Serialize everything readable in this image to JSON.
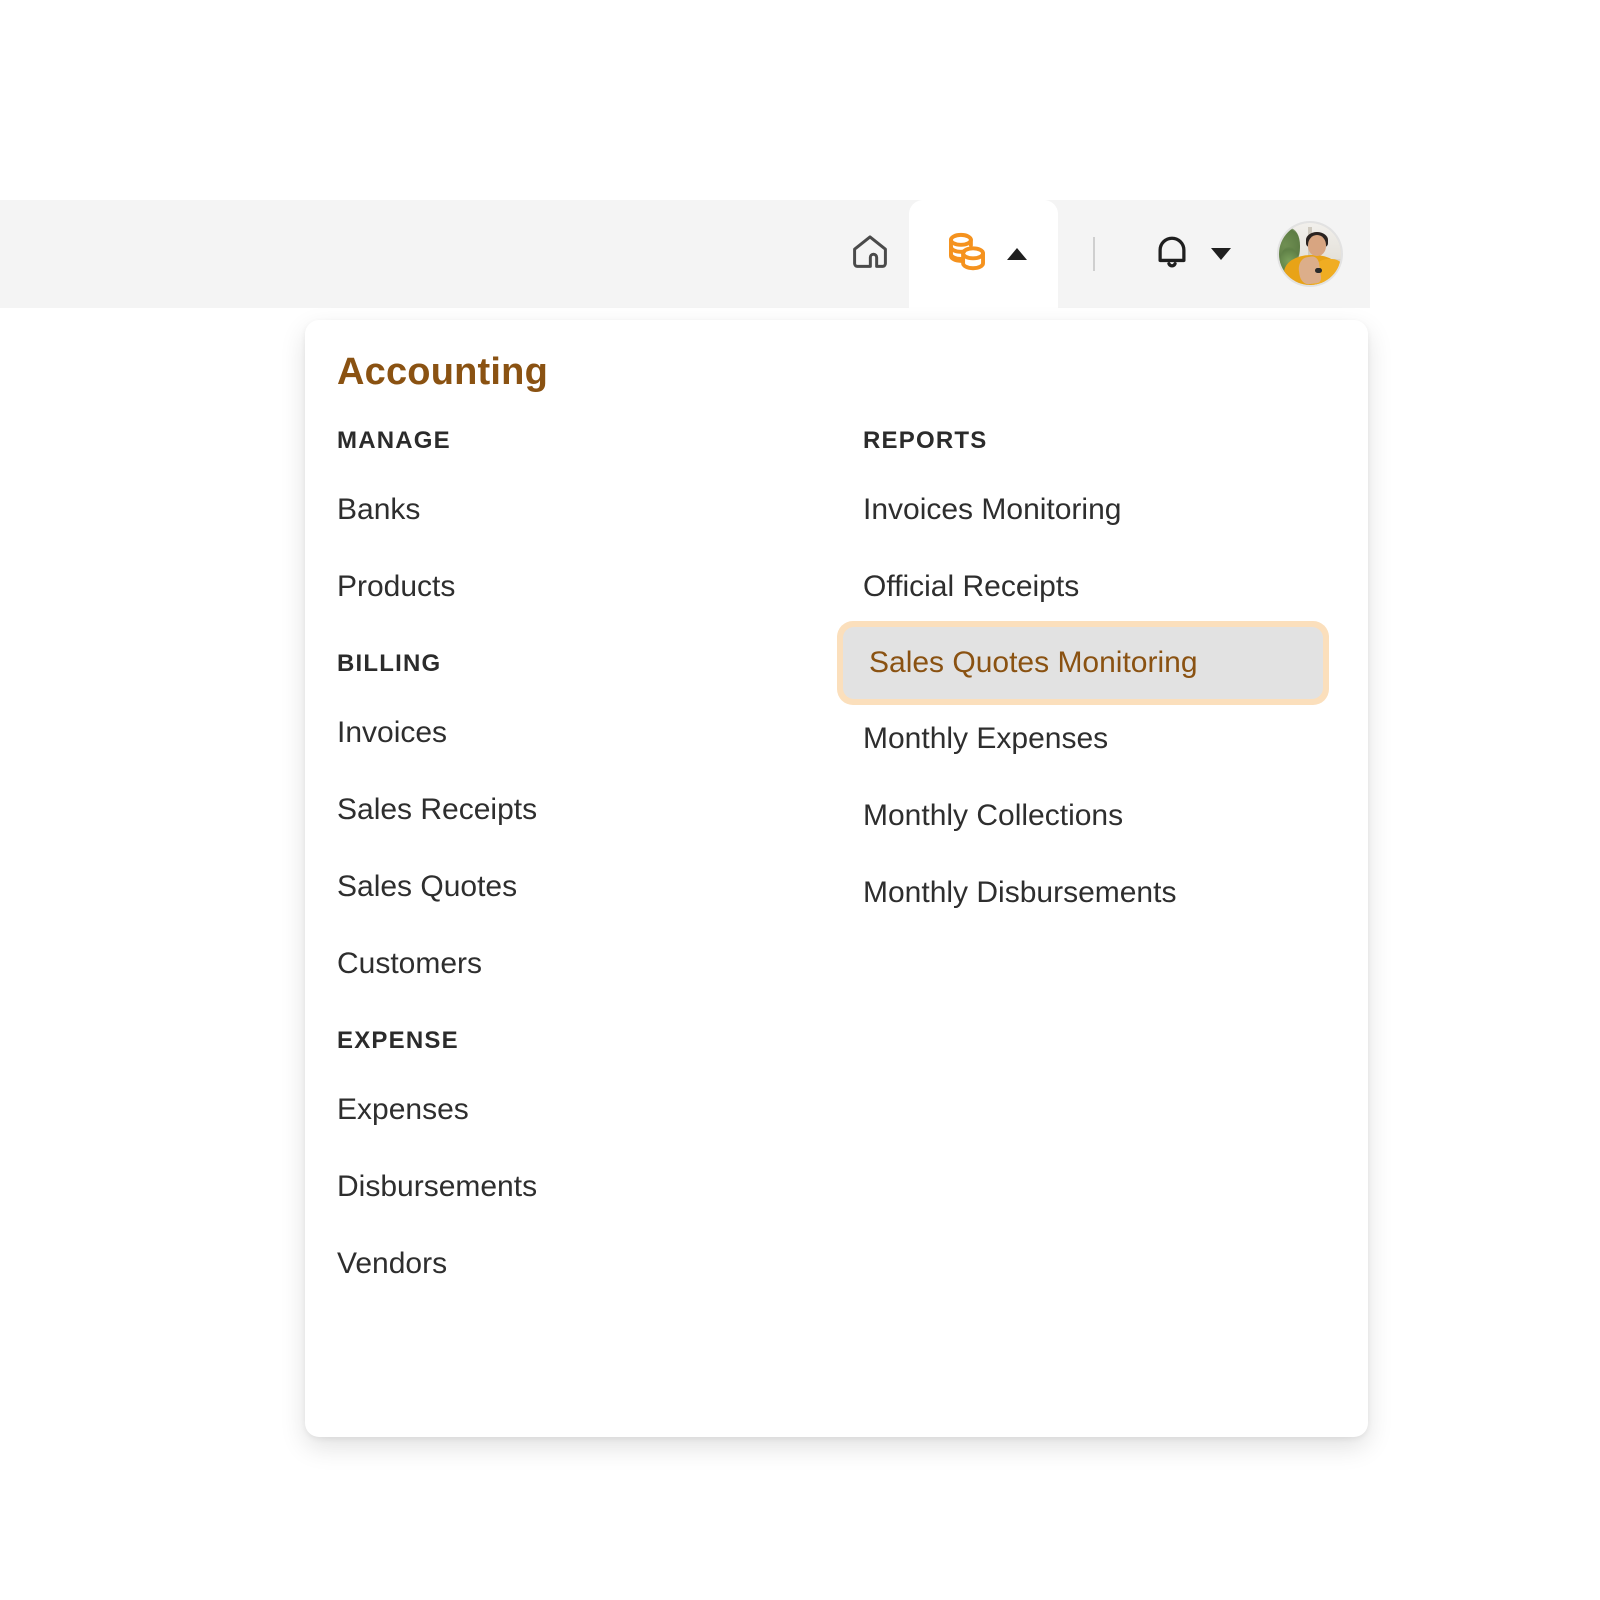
{
  "topbar": {
    "home_icon": "home-icon",
    "accounting_icon": "coins-icon",
    "accounting_caret": "caret-up-icon",
    "divider": "vertical-divider",
    "bell_icon": "bell-icon",
    "bell_caret": "caret-down-icon",
    "avatar": "user-avatar",
    "background": "#f4f4f4",
    "active_tab_background": "#ffffff",
    "accent_color": "#f5921e"
  },
  "menu": {
    "title": "Accounting",
    "title_color": "#8a5212",
    "left_column": [
      {
        "heading": "MANAGE",
        "items": [
          {
            "label": "Banks"
          },
          {
            "label": "Products"
          }
        ]
      },
      {
        "heading": "BILLING",
        "items": [
          {
            "label": "Invoices"
          },
          {
            "label": "Sales Receipts"
          },
          {
            "label": "Sales Quotes"
          },
          {
            "label": "Customers"
          }
        ]
      },
      {
        "heading": "EXPENSE",
        "items": [
          {
            "label": "Expenses"
          },
          {
            "label": "Disbursements"
          },
          {
            "label": "Vendors"
          }
        ]
      }
    ],
    "right_column": [
      {
        "heading": "REPORTS",
        "items": [
          {
            "label": "Invoices Monitoring",
            "highlighted": false
          },
          {
            "label": "Official Receipts",
            "highlighted": false
          },
          {
            "label": "Sales Quotes Monitoring",
            "highlighted": true
          },
          {
            "label": "Monthly Expenses",
            "highlighted": false
          },
          {
            "label": "Monthly Collections",
            "highlighted": false
          },
          {
            "label": "Monthly Disbursements",
            "highlighted": false
          }
        ]
      }
    ],
    "highlight": {
      "ring_color": "#fbdfbc",
      "fill_color": "#e2e2e2",
      "text_color": "#8a5212"
    }
  }
}
